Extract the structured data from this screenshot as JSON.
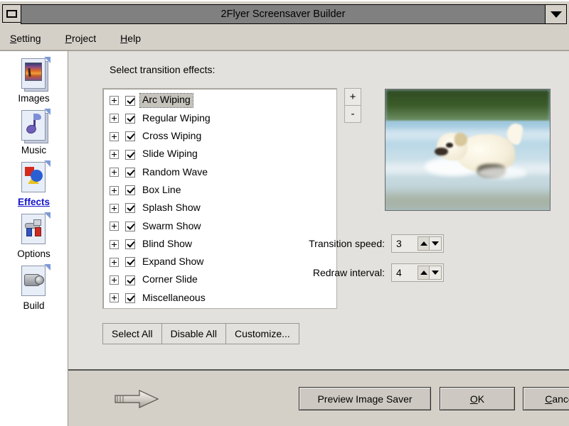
{
  "window": {
    "title": "2Flyer Screensaver Builder",
    "sysmenu_icon": "system-menu-icon",
    "minimize_icon": "chevron-down-icon"
  },
  "menubar": {
    "items": [
      {
        "label": "Setting",
        "accel": "S",
        "rest": "etting"
      },
      {
        "label": "Project",
        "accel": "P",
        "rest": "roject"
      },
      {
        "label": "Help",
        "accel": "H",
        "rest": "elp"
      }
    ]
  },
  "sidebar": {
    "items": [
      {
        "label": "Images",
        "icon": "images-page-icon",
        "selected": false
      },
      {
        "label": "Music",
        "icon": "music-note-icon",
        "selected": false
      },
      {
        "label": "Effects",
        "icon": "effects-shapes-icon",
        "selected": true
      },
      {
        "label": "Options",
        "icon": "options-faucet-icon",
        "selected": false
      },
      {
        "label": "Build",
        "icon": "build-camera-icon",
        "selected": false
      }
    ]
  },
  "main": {
    "section_label": "Select transition effects:",
    "effects": [
      {
        "label": "Arc Wiping",
        "checked": true,
        "selected": true
      },
      {
        "label": "Regular Wiping",
        "checked": true,
        "selected": false
      },
      {
        "label": "Cross Wiping",
        "checked": true,
        "selected": false
      },
      {
        "label": "Slide Wiping",
        "checked": true,
        "selected": false
      },
      {
        "label": "Random Wave",
        "checked": true,
        "selected": false
      },
      {
        "label": "Box Line",
        "checked": true,
        "selected": false
      },
      {
        "label": "Splash Show",
        "checked": true,
        "selected": false
      },
      {
        "label": "Swarm Show",
        "checked": true,
        "selected": false
      },
      {
        "label": "Blind Show",
        "checked": true,
        "selected": false
      },
      {
        "label": "Expand Show",
        "checked": true,
        "selected": false
      },
      {
        "label": "Corner Slide",
        "checked": true,
        "selected": false
      },
      {
        "label": "Miscellaneous",
        "checked": true,
        "selected": false
      }
    ],
    "zoom_buttons": {
      "plus_label": "+",
      "minus_label": "-"
    },
    "preview": {
      "alt": "White puppy running through shallow blue water",
      "colors": {
        "background_foliage": "#2e4a22",
        "water_light": "#b6d6e6",
        "puppy_fur": "#fffdf2"
      }
    },
    "settings": [
      {
        "label": "Transition speed:",
        "value": "3"
      },
      {
        "label": "Redraw interval:",
        "value": "4"
      }
    ],
    "list_buttons": [
      {
        "label": "Select All"
      },
      {
        "label": "Disable All"
      },
      {
        "label": "Customize..."
      }
    ]
  },
  "footer": {
    "arrow_icon": "arrow-right-icon",
    "buttons": [
      {
        "label": "Preview Image Saver",
        "accel": "",
        "rest": "Preview Image Saver"
      },
      {
        "label": "OK",
        "accel": "O",
        "rest": "K"
      },
      {
        "label": "Cancel",
        "accel": "C",
        "rest": "ancel"
      }
    ]
  },
  "colors": {
    "window_face": "#d4d0c8",
    "panel_face": "#e3e1dd",
    "titlebar_inactive": "#808080",
    "selected_link": "#1414cc",
    "listbox_bg": "#ffffff"
  }
}
